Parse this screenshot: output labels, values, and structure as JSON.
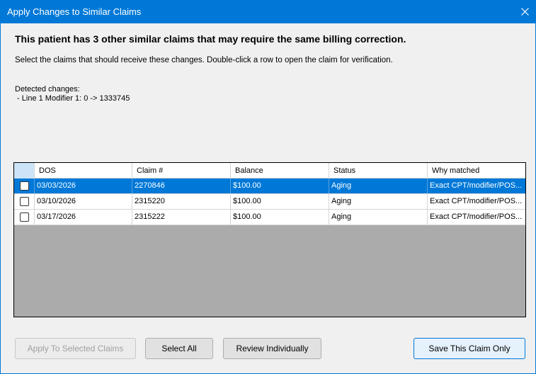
{
  "window": {
    "title": "Apply Changes to Similar Claims"
  },
  "icons": {
    "close": "close-icon"
  },
  "content": {
    "headline": "This patient has 3 other similar claims that may require the same billing correction.",
    "instruction": "Select the claims that should receive these changes. Double-click a row to open the claim for verification.",
    "changes_label": "Detected changes:",
    "changes": [
      " - Line 1 Modifier 1: 0 -> 1333745"
    ]
  },
  "grid": {
    "columns": [
      "DOS",
      "Claim #",
      "Balance",
      "Status",
      "Why matched"
    ],
    "rows": [
      {
        "dos": "03/03/2026",
        "claim": "2270846",
        "balance": "$100.00",
        "status": "Aging",
        "why": "Exact CPT/modifier/POS...",
        "checked": false,
        "selected": true
      },
      {
        "dos": "03/10/2026",
        "claim": "2315220",
        "balance": "$100.00",
        "status": "Aging",
        "why": "Exact CPT/modifier/POS...",
        "checked": false,
        "selected": false
      },
      {
        "dos": "03/17/2026",
        "claim": "2315222",
        "balance": "$100.00",
        "status": "Aging",
        "why": "Exact CPT/modifier/POS...",
        "checked": false,
        "selected": false
      }
    ]
  },
  "buttons": {
    "apply_selected": "Apply To Selected Claims",
    "select_all": "Select All",
    "review_individually": "Review Individually",
    "save_this_only": "Save This Claim Only"
  },
  "colors": {
    "titlebar": "#0078d7",
    "selected_row": "#0078d7",
    "grid_background": "#ababab"
  }
}
